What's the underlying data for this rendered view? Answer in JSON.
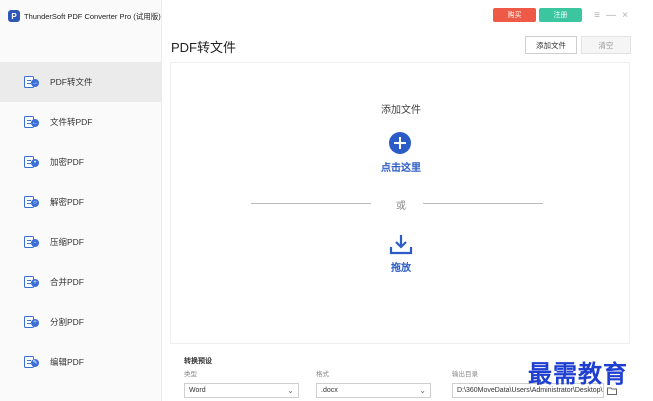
{
  "app": {
    "title": "ThunderSoft PDF Converter Pro (试用版)",
    "logo_letter": "P"
  },
  "titlebar": {
    "buy_label": "购买",
    "register_label": "注册",
    "menu_icon": "≡",
    "minimize_icon": "—",
    "close_icon": "×"
  },
  "sidebar": {
    "items": [
      {
        "label": "PDF转文件",
        "icon": "pdf-to-file-icon",
        "active": true
      },
      {
        "label": "文件转PDF",
        "icon": "file-to-pdf-icon"
      },
      {
        "label": "加密PDF",
        "icon": "encrypt-pdf-icon"
      },
      {
        "label": "解密PDF",
        "icon": "decrypt-pdf-icon"
      },
      {
        "label": "压缩PDF",
        "icon": "compress-pdf-icon"
      },
      {
        "label": "合并PDF",
        "icon": "merge-pdf-icon"
      },
      {
        "label": "分割PDF",
        "icon": "split-pdf-icon"
      },
      {
        "label": "编辑PDF",
        "icon": "edit-pdf-icon"
      }
    ]
  },
  "header": {
    "title": "PDF转文件",
    "add_files_label": "添加文件",
    "clear_label": "清空"
  },
  "dropzone": {
    "add_files_text": "添加文件",
    "click_here_text": "点击这里",
    "or_text": "或",
    "drag_drop_text": "拖放"
  },
  "settings": {
    "title": "转换预设",
    "type_label": "类型",
    "type_value": "Word",
    "format_label": "格式",
    "format_value": ".docx",
    "output_label": "输出目录",
    "output_value": "D:\\360MoveData\\Users\\Administrator\\Desktop\\"
  },
  "watermark": "最需教育",
  "colors": {
    "accent": "#2a5bc7",
    "buy": "#ee5a45",
    "register": "#3cc6a0"
  }
}
